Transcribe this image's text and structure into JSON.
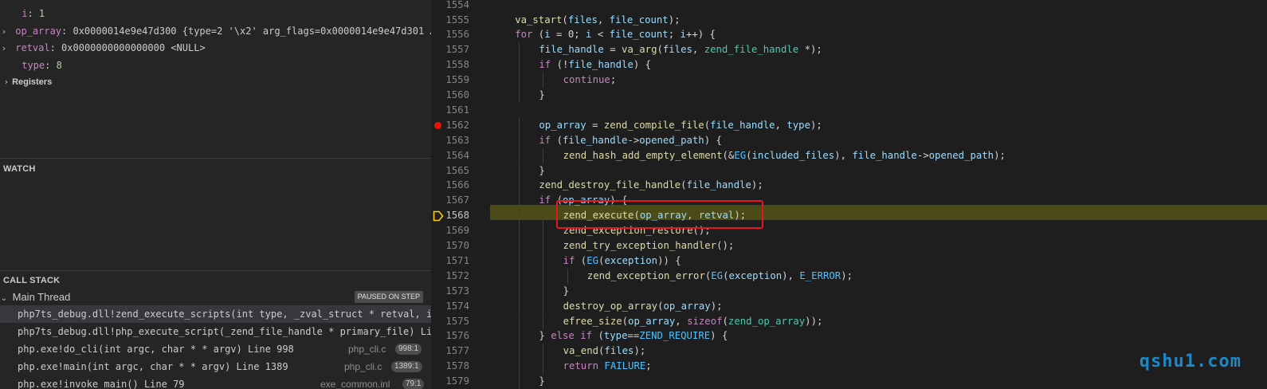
{
  "variables": [
    {
      "name": "i",
      "value": "1",
      "expandable": false
    },
    {
      "name": "op_array",
      "value": "0x0000014e9e47d300 {type=2 '\\x2' arg_flags=0x0000014e9e47d301 …",
      "expandable": true
    },
    {
      "name": "retval",
      "value": "0x0000000000000000 <NULL>",
      "expandable": true
    },
    {
      "name": "type",
      "value": "8",
      "expandable": false
    }
  ],
  "registers_label": "Registers",
  "watch_header": "WATCH",
  "callstack_header": "CALL STACK",
  "thread": {
    "name": "Main Thread",
    "status": "PAUSED ON STEP"
  },
  "call_stack": [
    {
      "name": "php7ts_debug.dll!zend_execute_scripts(int type, _zval_struct * retval, int",
      "file": "",
      "line": ""
    },
    {
      "name": "php7ts_debug.dll!php_execute_script(_zend_file_handle * primary_file) Line",
      "file": "",
      "line": ""
    },
    {
      "name": "php.exe!do_cli(int argc, char * * argv) Line 998",
      "file": "php_cli.c",
      "line": "998:1"
    },
    {
      "name": "php.exe!main(int argc, char * * argv) Line 1389",
      "file": "php_cli.c",
      "line": "1389:1"
    },
    {
      "name": "php.exe!invoke_main() Line 79",
      "file": "exe_common.inl",
      "line": "79:1"
    }
  ],
  "code_lines": [
    {
      "n": "1554",
      "t": ""
    },
    {
      "n": "1555",
      "t": "va_start(files, file_count);"
    },
    {
      "n": "1556",
      "t": "for (i = 0; i < file_count; i++) {"
    },
    {
      "n": "1557",
      "t": "file_handle = va_arg(files, zend_file_handle *);"
    },
    {
      "n": "1558",
      "t": "if (!file_handle) {"
    },
    {
      "n": "1559",
      "t": "continue;"
    },
    {
      "n": "1560",
      "t": "}"
    },
    {
      "n": "1561",
      "t": ""
    },
    {
      "n": "1562",
      "t": "op_array = zend_compile_file(file_handle, type);"
    },
    {
      "n": "1563",
      "t": "if (file_handle->opened_path) {"
    },
    {
      "n": "1564",
      "t": "zend_hash_add_empty_element(&EG(included_files), file_handle->opened_path);"
    },
    {
      "n": "1565",
      "t": "}"
    },
    {
      "n": "1566",
      "t": "zend_destroy_file_handle(file_handle);"
    },
    {
      "n": "1567",
      "t": "if (op_array) {"
    },
    {
      "n": "1568",
      "t": "zend_execute(op_array, retval);"
    },
    {
      "n": "1569",
      "t": "zend_exception_restore();"
    },
    {
      "n": "1570",
      "t": "zend_try_exception_handler();"
    },
    {
      "n": "1571",
      "t": "if (EG(exception)) {"
    },
    {
      "n": "1572",
      "t": "zend_exception_error(EG(exception), E_ERROR);"
    },
    {
      "n": "1573",
      "t": "}"
    },
    {
      "n": "1574",
      "t": "destroy_op_array(op_array);"
    },
    {
      "n": "1575",
      "t": "efree_size(op_array, sizeof(zend_op_array));"
    },
    {
      "n": "1576",
      "t": "} else if (type==ZEND_REQUIRE) {"
    },
    {
      "n": "1577",
      "t": "va_end(files);"
    },
    {
      "n": "1578",
      "t": "return FAILURE;"
    },
    {
      "n": "1579",
      "t": "}"
    }
  ],
  "breakpoint_line": "1562",
  "current_line": "1568",
  "watermark": "qshu1.com",
  "colors": {
    "breakpoint": "#e51400",
    "current_line_bg": "#4b4b18",
    "highlight_box": "#e8141e",
    "watermark": "#1e88c7"
  }
}
